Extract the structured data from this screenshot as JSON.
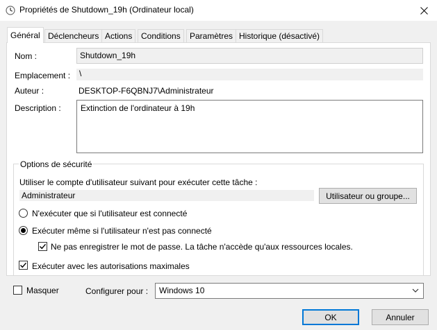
{
  "window": {
    "title": "Propriétés de Shutdown_19h (Ordinateur local)",
    "icon": "clock-icon"
  },
  "tabs": [
    {
      "label": "Général",
      "active": true
    },
    {
      "label": "Déclencheurs",
      "active": false
    },
    {
      "label": "Actions",
      "active": false
    },
    {
      "label": "Conditions",
      "active": false
    },
    {
      "label": "Paramètres",
      "active": false
    },
    {
      "label": "Historique (désactivé)",
      "active": false
    }
  ],
  "general": {
    "name_label": "Nom :",
    "name_value": "Shutdown_19h",
    "location_label": "Emplacement :",
    "location_value": "\\",
    "author_label": "Auteur :",
    "author_value": "DESKTOP-F6QBNJ7\\Administrateur",
    "description_label": "Description :",
    "description_value": "Extinction de l'ordinateur à 19h"
  },
  "security": {
    "legend": "Options de sécurité",
    "user_account_label": "Utiliser le compte d'utilisateur suivant pour exécuter cette tâche :",
    "user_account_value": "Administrateur",
    "user_button_label": "Utilisateur ou groupe...",
    "radio_logged_on_label": "N'exécuter que si l'utilisateur est connecté",
    "radio_logged_on_checked": false,
    "radio_whether_label": "Exécuter même si l'utilisateur n'est pas connecté",
    "radio_whether_checked": true,
    "no_store_password_label": "Ne pas enregistrer le mot de passe. La tâche n'accède qu'aux ressources locales.",
    "no_store_password_checked": true,
    "highest_privileges_label": "Exécuter avec les autorisations maximales",
    "highest_privileges_checked": true
  },
  "bottom": {
    "hidden_label": "Masquer",
    "hidden_checked": false,
    "configure_label": "Configurer pour :",
    "configure_value": "Windows 10"
  },
  "buttons": {
    "ok": "OK",
    "cancel": "Annuler"
  },
  "colors": {
    "window_bg": "#f0f0f0",
    "panel_bg": "#ffffff",
    "accent": "#0078d7",
    "button_bg": "#e1e1e1"
  }
}
